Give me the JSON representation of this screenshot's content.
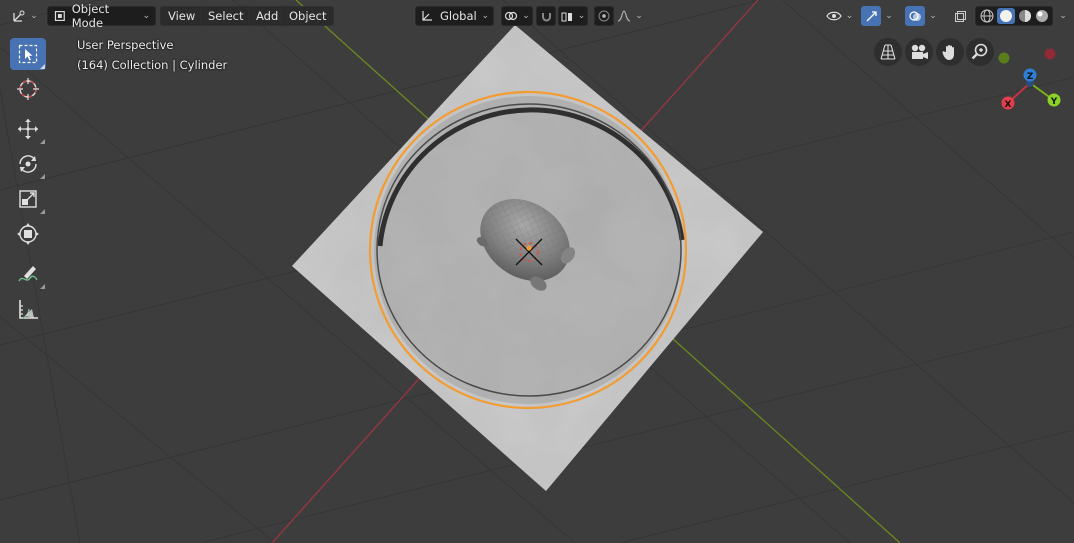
{
  "header": {
    "mode_label": "Object Mode",
    "menu_view": "View",
    "menu_select": "Select",
    "menu_add": "Add",
    "menu_object": "Object",
    "orientation_label": "Global"
  },
  "viewport_info": {
    "perspective": "User Perspective",
    "collection": "(164) Collection | Cylinder"
  },
  "gizmo": {
    "z": "Z",
    "x": "X",
    "y": "Y"
  },
  "colors": {
    "background": "#3d3d3d",
    "grid": "#363636",
    "x_axis": "#9b3540",
    "y_axis": "#6b8a1f",
    "selection_outline": "#f39c33",
    "active_tool": "#4772b3"
  },
  "icons": {
    "editor_type": "editor-type-icon",
    "select_tool": "select-box-icon",
    "cursor_tool": "cursor-icon",
    "move_tool": "move-icon",
    "rotate_tool": "rotate-icon",
    "scale_tool": "scale-icon",
    "transform_tool": "transform-icon",
    "annotate_tool": "annotate-icon",
    "measure_tool": "measure-icon"
  }
}
